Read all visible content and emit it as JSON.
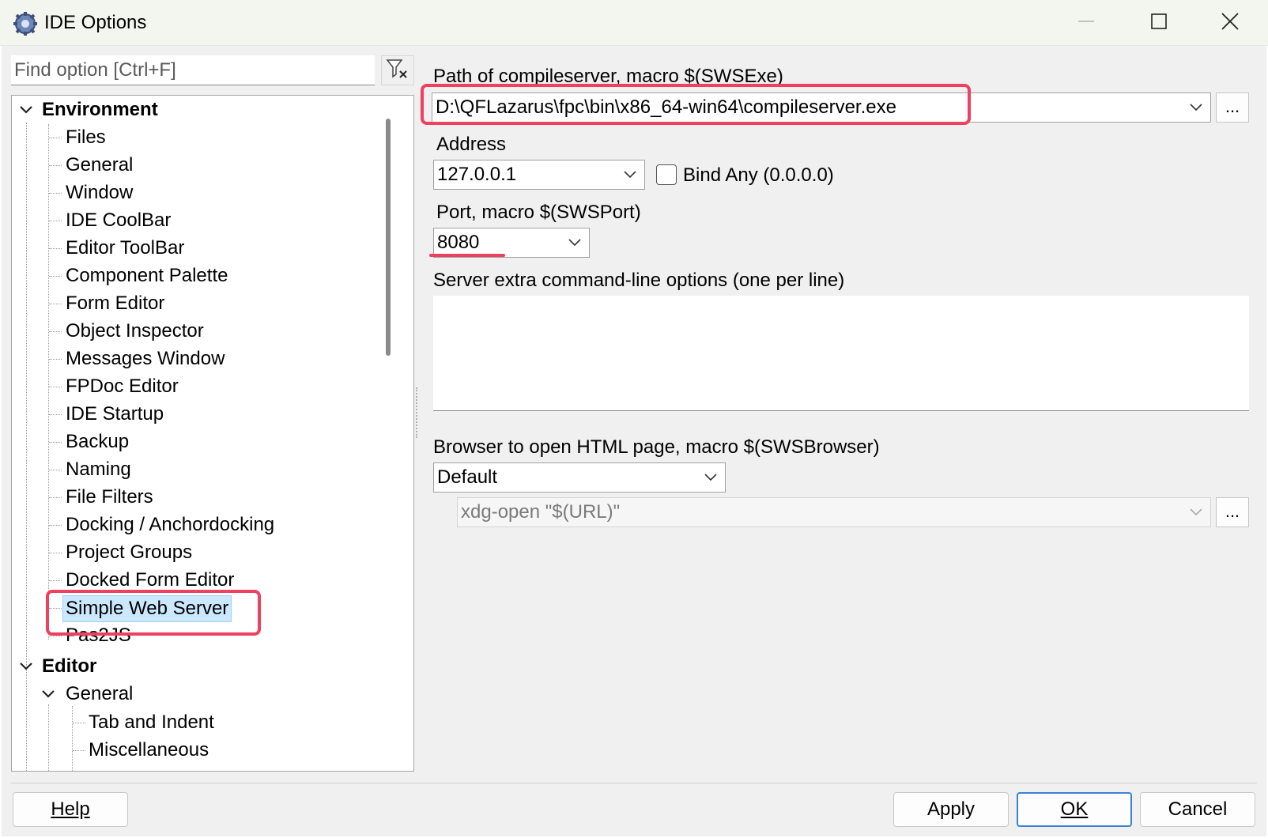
{
  "window": {
    "title": "IDE Options",
    "controls": [
      "minimize-icon",
      "maximize-icon",
      "close-icon"
    ]
  },
  "search": {
    "placeholder": "Find option [Ctrl+F]"
  },
  "tree": {
    "environment": {
      "label": "Environment",
      "items": [
        "Files",
        "General",
        "Window",
        "IDE CoolBar",
        "Editor ToolBar",
        "Component Palette",
        "Form Editor",
        "Object Inspector",
        "Messages Window",
        "FPDoc Editor",
        "IDE Startup",
        "Backup",
        "Naming",
        "File Filters",
        "Docking / Anchordocking",
        "Project Groups",
        "Docked Form Editor",
        "Simple Web Server",
        "Pas2JS"
      ],
      "selected": "Simple Web Server"
    },
    "editor": {
      "label": "Editor",
      "general": {
        "label": "General",
        "items": [
          "Tab and Indent",
          "Miscellaneous"
        ]
      }
    }
  },
  "settings": {
    "compileserver": {
      "label": "Path of compileserver, macro $(SWSExe)",
      "value": "D:\\QFLazarus\\fpc\\bin\\x86_64-win64\\compileserver.exe",
      "browse": "..."
    },
    "address": {
      "label": "Address",
      "value": "127.0.0.1"
    },
    "bind_any": {
      "label": "Bind Any (0.0.0.0)",
      "checked": false
    },
    "port": {
      "label": "Port, macro $(SWSPort)",
      "value": "8080"
    },
    "extra_options": {
      "label": "Server extra command-line options (one per line)",
      "value": ""
    },
    "browser": {
      "label": "Browser to open HTML page, macro $(SWSBrowser)",
      "value": "Default",
      "command": "xdg-open \"$(URL)\"",
      "browse": "..."
    }
  },
  "buttons": {
    "help": "Help",
    "apply": "Apply",
    "ok": "OK",
    "cancel": "Cancel"
  },
  "colors": {
    "highlight": "#ee4060",
    "selection": "#cce8ff",
    "default_button_border": "#3a80d6"
  }
}
